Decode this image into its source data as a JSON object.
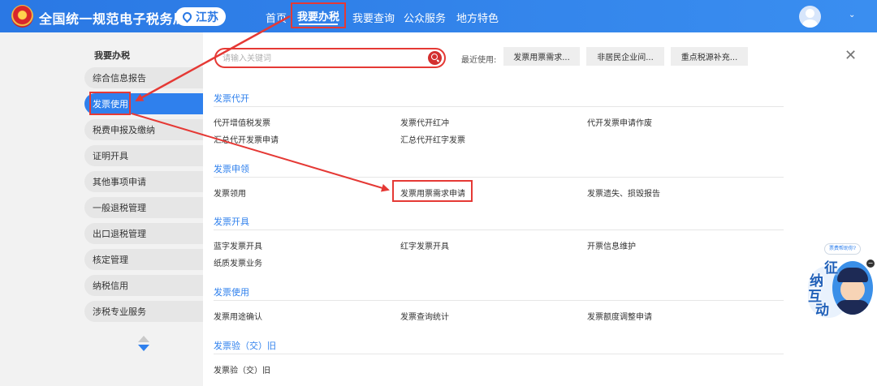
{
  "header": {
    "site_title": "全国统一规范电子税务局",
    "region": "江苏",
    "nav": [
      "首页",
      "我要办税",
      "我要查询",
      "公众服务",
      "地方特色"
    ]
  },
  "sidebar": {
    "title": "我要办税",
    "items": [
      {
        "label": "综合信息报告",
        "active": false
      },
      {
        "label": "发票使用",
        "active": true
      },
      {
        "label": "税费申报及缴纳",
        "active": false
      },
      {
        "label": "证明开具",
        "active": false
      },
      {
        "label": "其他事项申请",
        "active": false
      },
      {
        "label": "一般退税管理",
        "active": false
      },
      {
        "label": "出口退税管理",
        "active": false
      },
      {
        "label": "核定管理",
        "active": false
      },
      {
        "label": "纳税信用",
        "active": false
      },
      {
        "label": "涉税专业服务",
        "active": false
      }
    ]
  },
  "search": {
    "placeholder": "请输入关键词"
  },
  "recent": {
    "label": "最近使用:",
    "items": [
      "发票用票需求...",
      "非居民企业间...",
      "重点税源补充..."
    ]
  },
  "sections": [
    {
      "title": "发票代开",
      "rows": [
        [
          "代开增值税发票",
          "发票代开红冲",
          "代开发票申请作废"
        ],
        [
          "汇总代开发票申请",
          "汇总代开红字发票",
          ""
        ]
      ]
    },
    {
      "title": "发票申领",
      "rows": [
        [
          "发票领用",
          "发票用票需求申请",
          "发票遗失、损毁报告"
        ]
      ]
    },
    {
      "title": "发票开具",
      "rows": [
        [
          "蓝字发票开具",
          "红字发票开具",
          "开票信息维护"
        ],
        [
          "纸质发票业务",
          "",
          ""
        ]
      ]
    },
    {
      "title": "发票使用",
      "rows": [
        [
          "发票用途确认",
          "发票查询统计",
          "发票额度调整申请"
        ]
      ]
    },
    {
      "title": "发票验（交）旧",
      "rows": [
        [
          "发票验（交）旧",
          "",
          ""
        ]
      ]
    }
  ],
  "assistant": {
    "tip": "票费帮助你?",
    "chars": [
      "征",
      "纳",
      "互",
      "动"
    ]
  },
  "colors": {
    "header_blue": "#2f80ed",
    "highlight_red": "#e53935",
    "section_blue": "#2f80ed"
  }
}
